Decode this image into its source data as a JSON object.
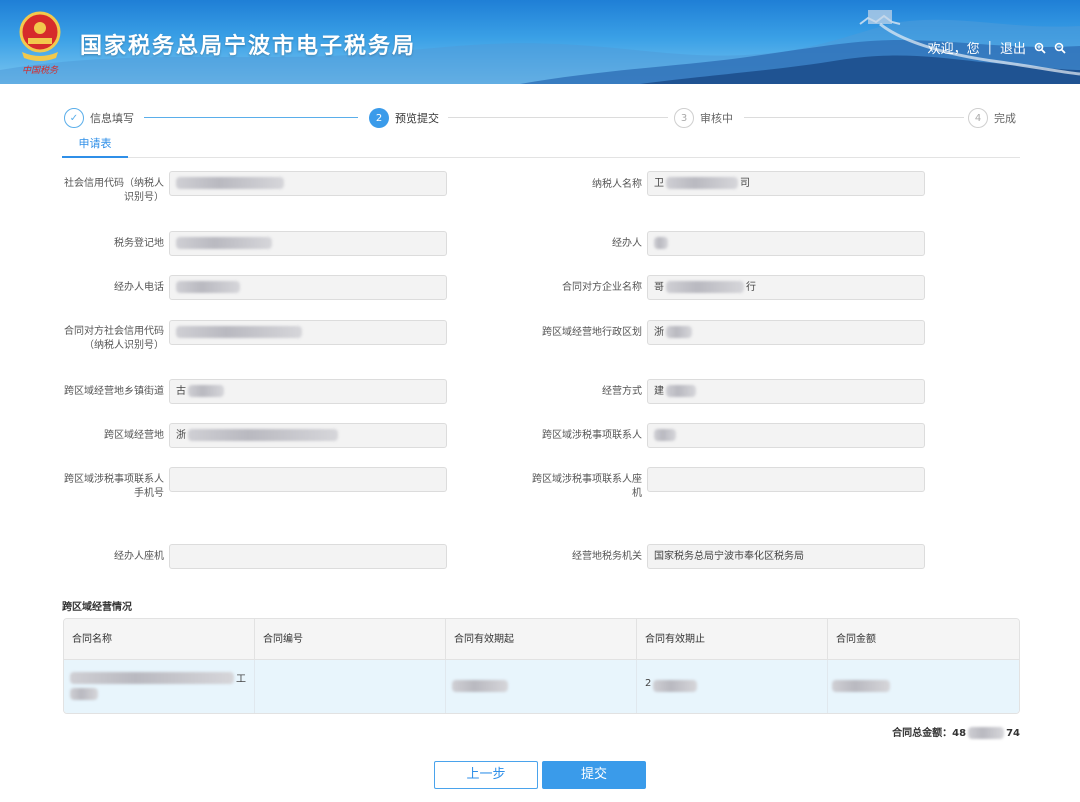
{
  "header": {
    "title": "国家税务总局宁波市电子税务局",
    "welcome": "欢迎，您",
    "separator": "|",
    "logout": "退出",
    "logo_text": "中国税务"
  },
  "steps": [
    {
      "num": "✓",
      "label": "信息填写",
      "state": "done"
    },
    {
      "num": "2",
      "label": "预览提交",
      "state": "active"
    },
    {
      "num": "3",
      "label": "审核中",
      "state": "todo"
    },
    {
      "num": "4",
      "label": "完成",
      "state": "todo"
    }
  ],
  "tab": {
    "label": "申请表"
  },
  "form": {
    "credit_code_label": "社会信用代码（纳税人识别号）",
    "taxpayer_name_label": "纳税人名称",
    "taxpayer_name_prefix": "卫",
    "taxpayer_name_suffix": "司",
    "tax_reg_place_label": "税务登记地",
    "handler_label": "经办人",
    "handler_phone_label": "经办人电话",
    "counterparty_name_label": "合同对方企业名称",
    "counterparty_name_prefix": "哥",
    "counterparty_name_suffix": "行",
    "counterparty_code_label": "合同对方社会信用代码（纳税人识别号）",
    "cross_region_admin_label": "跨区域经营地行政区划",
    "cross_region_admin_prefix": "浙",
    "cross_region_street_label": "跨区域经营地乡镇街道",
    "cross_region_street_prefix": "古",
    "business_mode_label": "经营方式",
    "business_mode_prefix": "建",
    "cross_region_place_label": "跨区域经营地",
    "cross_region_place_prefix": "浙",
    "tax_contact_label": "跨区域涉税事项联系人",
    "tax_contact_mobile_label": "跨区域涉税事项联系人手机号",
    "tax_contact_landline_label": "跨区域涉税事项联系人座机",
    "handler_landline_label": "经办人座机",
    "tax_office_label": "经营地税务机关",
    "tax_office_value": "国家税务总局宁波市奉化区税务局"
  },
  "contracts": {
    "section_title": "跨区域经营情况",
    "columns": [
      "合同名称",
      "合同编号",
      "合同有效期起",
      "合同有效期止",
      "合同金额"
    ],
    "row_name_suffix": "工",
    "row_end_prefix": "2",
    "total_label": "合同总金额：",
    "total_prefix": "48",
    "total_suffix": "74"
  },
  "buttons": {
    "prev": "上一步",
    "submit": "提交"
  },
  "colors": {
    "accent": "#2f8fe8",
    "header_bg": "#3aa0e6",
    "row_highlight": "#e8f5fc"
  }
}
